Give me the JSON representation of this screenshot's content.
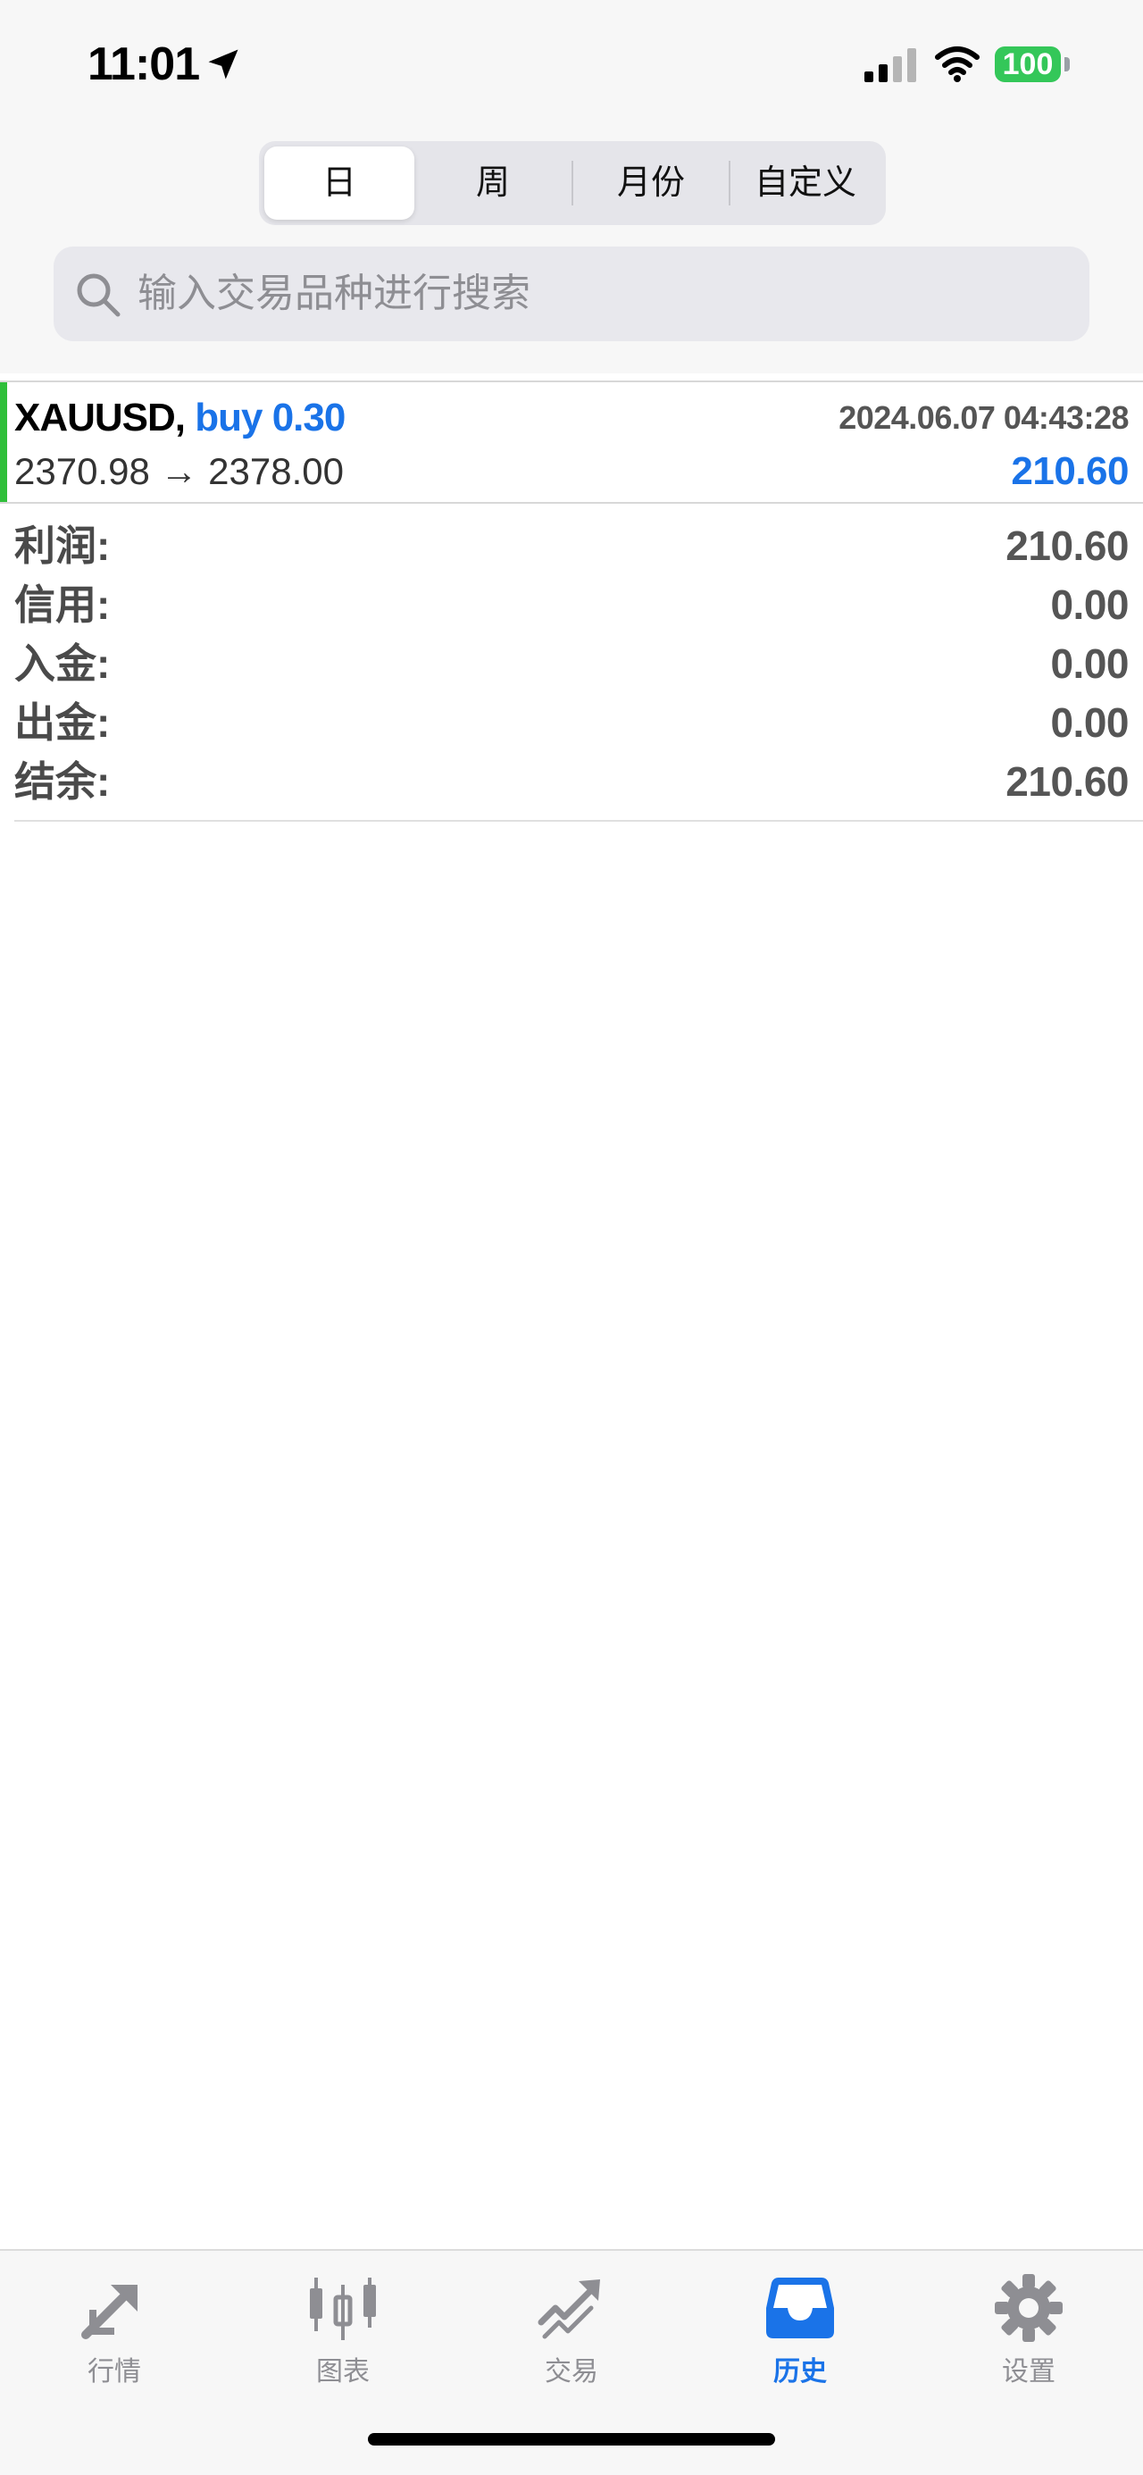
{
  "status_bar": {
    "time": "11:01",
    "battery": "100"
  },
  "period_tabs": [
    {
      "label": "日",
      "active": true
    },
    {
      "label": "周",
      "active": false
    },
    {
      "label": "月份",
      "active": false
    },
    {
      "label": "自定义",
      "active": false
    }
  ],
  "search": {
    "placeholder": "输入交易品种进行搜索",
    "value": ""
  },
  "deal": {
    "symbol": "XAUUSD,",
    "type": "buy 0.30",
    "time": "2024.06.07 04:43:28",
    "prices": "2370.98 → 2378.00",
    "profit": "210.60"
  },
  "summary": [
    {
      "label": "利润:",
      "value": "210.60"
    },
    {
      "label": "信用:",
      "value": "0.00"
    },
    {
      "label": "入金:",
      "value": "0.00"
    },
    {
      "label": "出金:",
      "value": "0.00"
    },
    {
      "label": "结余:",
      "value": "210.60"
    }
  ],
  "tabs": [
    {
      "label": "行情",
      "icon": "quotes-icon",
      "active": false
    },
    {
      "label": "图表",
      "icon": "chart-icon",
      "active": false
    },
    {
      "label": "交易",
      "icon": "trade-icon",
      "active": false
    },
    {
      "label": "历史",
      "icon": "history-icon",
      "active": true
    },
    {
      "label": "设置",
      "icon": "settings-icon",
      "active": false
    }
  ],
  "colors": {
    "accent": "#1a73e8",
    "buy_bar": "#2fbf3a",
    "battery": "#34c759"
  }
}
